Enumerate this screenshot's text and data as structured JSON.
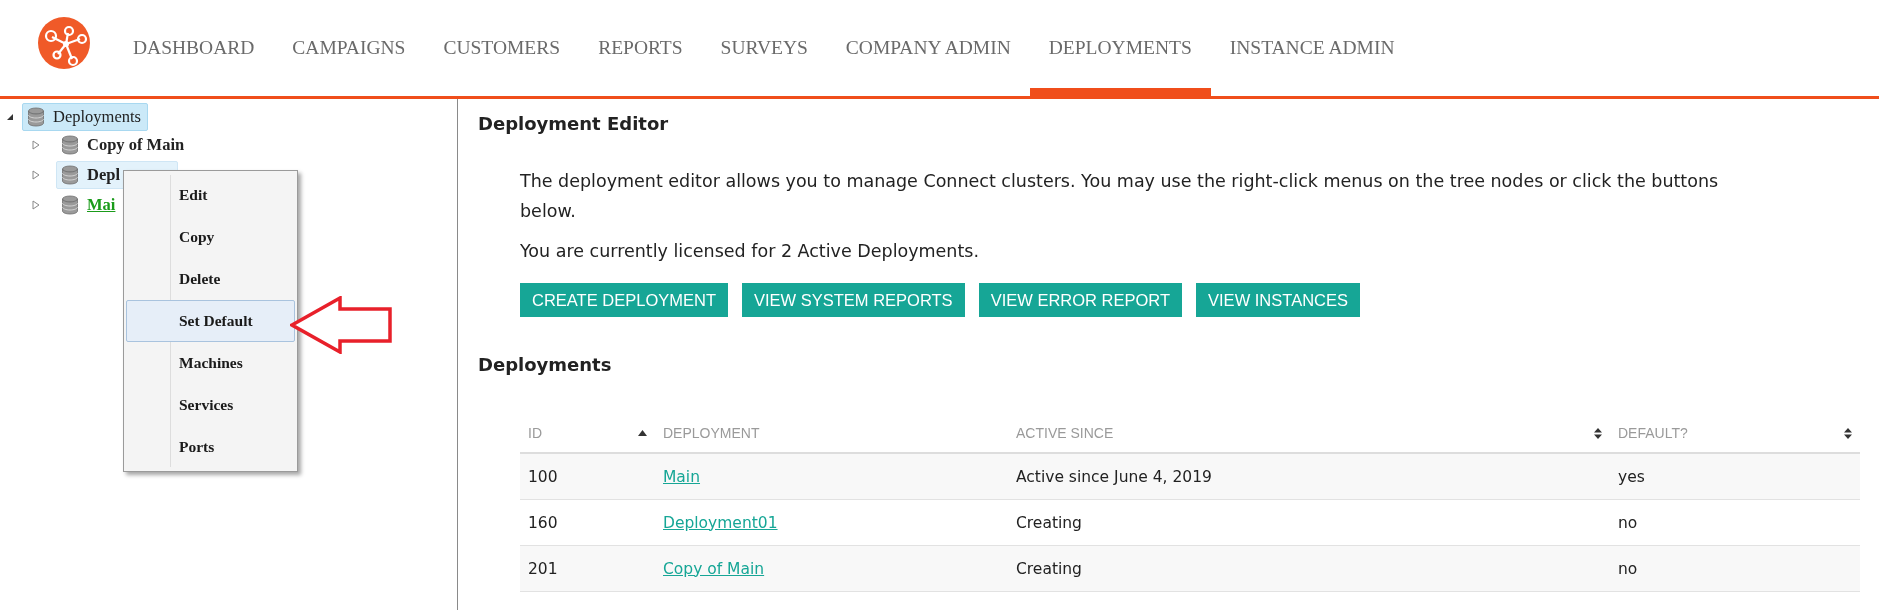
{
  "header": {
    "nav": [
      {
        "label": "DASHBOARD",
        "selected": false
      },
      {
        "label": "CAMPAIGNS",
        "selected": false
      },
      {
        "label": "CUSTOMERS",
        "selected": false
      },
      {
        "label": "REPORTS",
        "selected": false
      },
      {
        "label": "SURVEYS",
        "selected": false
      },
      {
        "label": "COMPANY ADMIN",
        "selected": false
      },
      {
        "label": "DEPLOYMENTS",
        "selected": true
      },
      {
        "label": "INSTANCE ADMIN",
        "selected": false
      }
    ]
  },
  "tree": {
    "root": {
      "label": "Deployments",
      "expanded": true,
      "selected": true,
      "children": [
        {
          "label": "Copy of Main",
          "expanded": false,
          "selected": false,
          "default": false
        },
        {
          "label": "Depl",
          "expanded": false,
          "selected": true,
          "default": false
        },
        {
          "label": "Mai",
          "expanded": false,
          "selected": false,
          "default": true
        }
      ]
    }
  },
  "context_menu": {
    "items": [
      {
        "label": "Edit",
        "selected": false
      },
      {
        "label": "Copy",
        "selected": false
      },
      {
        "label": "Delete",
        "selected": false
      },
      {
        "label": "Set Default",
        "selected": true
      },
      {
        "label": "Machines",
        "selected": false
      },
      {
        "label": "Services",
        "selected": false
      },
      {
        "label": "Ports",
        "selected": false
      }
    ]
  },
  "editor": {
    "title": "Deployment Editor",
    "description": "The deployment editor allows you to manage Connect clusters. You may use the right-click menus on the tree nodes or click the buttons below.",
    "license_note": "You are currently licensed for 2 Active Deployments.",
    "buttons": [
      "CREATE DEPLOYMENT",
      "VIEW SYSTEM REPORTS",
      "VIEW ERROR REPORT",
      "VIEW INSTANCES"
    ],
    "deployments_title": "Deployments",
    "table": {
      "columns": [
        {
          "label": "ID",
          "kind": "sorted"
        },
        {
          "label": "DEPLOYMENT",
          "kind": "plain"
        },
        {
          "label": "ACTIVE SINCE",
          "kind": "sortable"
        },
        {
          "label": "DEFAULT?",
          "kind": "sortable"
        }
      ],
      "rows": [
        {
          "id": "100",
          "deployment": "Main",
          "active_since": "Active since June 4, 2019",
          "default": "yes"
        },
        {
          "id": "160",
          "deployment": "Deployment01",
          "active_since": "Creating",
          "default": "no"
        },
        {
          "id": "201",
          "deployment": "Copy of Main",
          "active_since": "Creating",
          "default": "no"
        }
      ]
    }
  }
}
